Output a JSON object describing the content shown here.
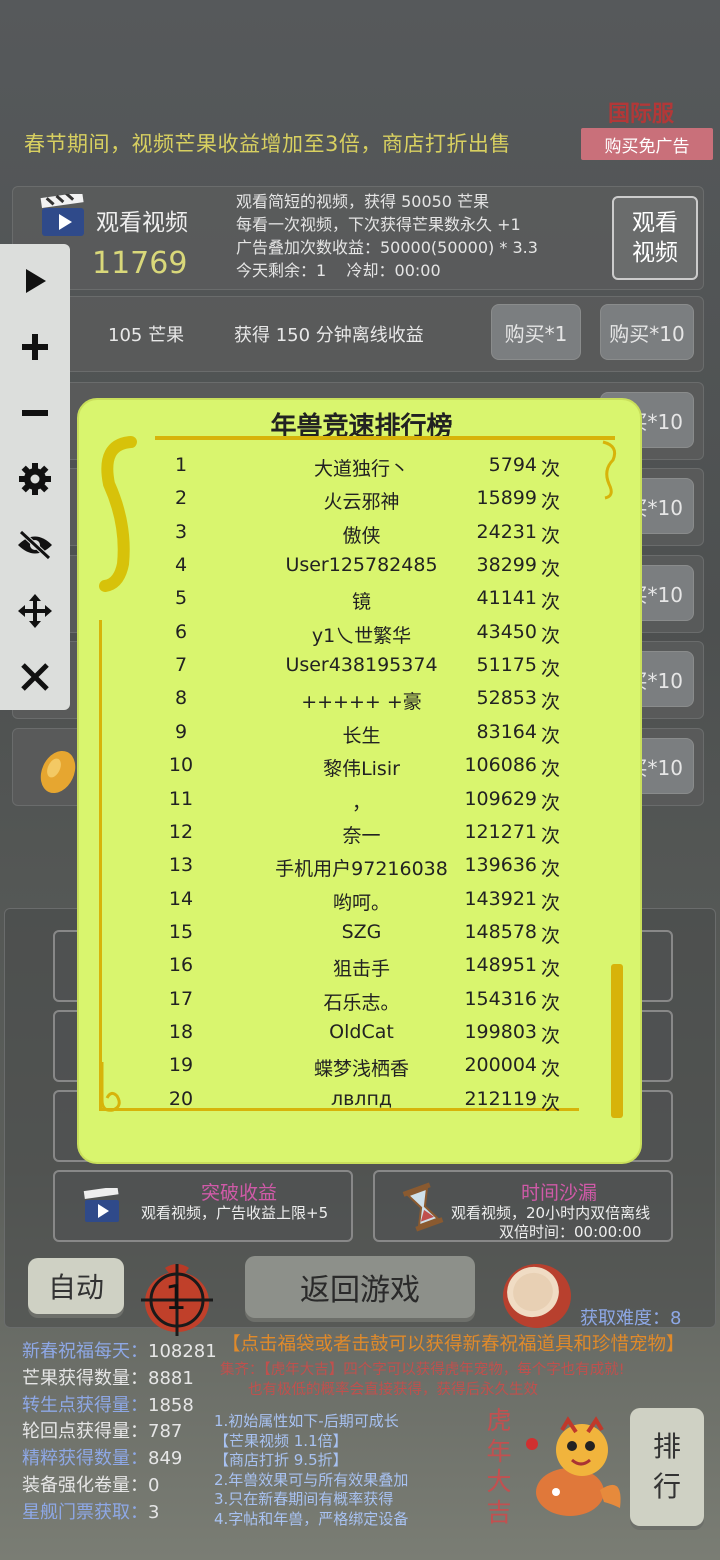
{
  "header": {
    "notice": "春节期间，视频芒果收益增加至3倍，商店打折出售",
    "intl_label": "国际服",
    "no_ad_button": "购买免广告"
  },
  "video_row": {
    "title": "观看视频",
    "count": "11769",
    "desc": [
      "观看简短的视频，获得 50050 芒果",
      "每看一次视频，下次获得芒果数永久 +1",
      "广告叠加次数收益：50000(50000) * 3.3",
      "今天剩余：1    冷却：00:00"
    ],
    "button": "观看\n视频"
  },
  "shop_row": {
    "price": "105 芒果",
    "desc": "获得 150 分钟离线收益",
    "buy1": "购买*1",
    "buy10": "购买*10"
  },
  "hidden_buy10": "买*10",
  "toolbar": {
    "items": [
      "play-icon",
      "plus-icon",
      "minus-icon",
      "gear-icon",
      "eye-off-icon",
      "move-icon",
      "close-icon"
    ]
  },
  "leaderboard": {
    "title": "年兽竞速排行榜",
    "unit": "次",
    "rows": [
      {
        "rank": "1",
        "name": "大道独行丶",
        "score": "5794"
      },
      {
        "rank": "2",
        "name": "火云邪神",
        "score": "15899"
      },
      {
        "rank": "3",
        "name": "傲侠",
        "score": "24231"
      },
      {
        "rank": "4",
        "name": "User125782485",
        "score": "38299"
      },
      {
        "rank": "5",
        "name": "镜",
        "score": "41141"
      },
      {
        "rank": "6",
        "name": "y1乀世繁华",
        "score": "43450"
      },
      {
        "rank": "7",
        "name": "User438195374",
        "score": "51175"
      },
      {
        "rank": "8",
        "name": "+++++     +豪",
        "score": "52853"
      },
      {
        "rank": "9",
        "name": "长生",
        "score": "83164"
      },
      {
        "rank": "10",
        "name": "黎伟Lisir",
        "score": "106086"
      },
      {
        "rank": "11",
        "name": "，",
        "score": "109629"
      },
      {
        "rank": "12",
        "name": "奈一",
        "score": "121271"
      },
      {
        "rank": "13",
        "name": "手机用户97216038",
        "score": "139636"
      },
      {
        "rank": "14",
        "name": "哟呵。",
        "score": "143921"
      },
      {
        "rank": "15",
        "name": "SZG",
        "score": "148578"
      },
      {
        "rank": "16",
        "name": "狙击手",
        "score": "148951"
      },
      {
        "rank": "17",
        "name": "石乐志。",
        "score": "154316"
      },
      {
        "rank": "18",
        "name": "OldCat",
        "score": "199803"
      },
      {
        "rank": "19",
        "name": "蝶梦浅栖香",
        "score": "200004"
      },
      {
        "rank": "20",
        "name": "лвлпд",
        "score": "212119"
      }
    ]
  },
  "cards": {
    "breakthrough": {
      "title": "突破收益",
      "desc": "观看视频，广告收益上限+5"
    },
    "hourglass": {
      "title": "时间沙漏",
      "desc1": "观看视频，20小时内双倍离线",
      "desc2": "双倍时间：00:00:00"
    }
  },
  "bottom": {
    "auto": "自动",
    "target_number": "1",
    "return": "返回游戏",
    "difficulty": "获取难度：8",
    "hint": "【点击福袋或者击鼓可以获得新春祝福道具和珍惜宠物】",
    "collect1": "集齐：【虎年大吉】四个字可以获得虎年宠物，每个字也有成就!",
    "collect2": "也有极低的概率会直接获得，获得后永久生效",
    "rank_button": "排\n行",
    "tiger": [
      "虎",
      "年",
      "大",
      "吉"
    ]
  },
  "stats": [
    {
      "label": "新春祝福每天：",
      "value": "108281"
    },
    {
      "label": "芒果获得数量：",
      "value": "8881"
    },
    {
      "label": "转生点获得量：",
      "value": "1858"
    },
    {
      "label": "轮回点获得量：",
      "value": "787"
    },
    {
      "label": "精粹获得数量：",
      "value": "849"
    },
    {
      "label": "装备强化卷量：",
      "value": "0"
    },
    {
      "label": "星舰门票获取：",
      "value": "3"
    }
  ],
  "notes": [
    "1.初始属性如下-后期可成长",
    "【芒果视频 1.1倍】",
    "【商店打折 9.5折】",
    "2.年兽效果可与所有效果叠加",
    "3.只在新春期间有概率获得",
    "4.字帖和年兽，严格绑定设备"
  ]
}
